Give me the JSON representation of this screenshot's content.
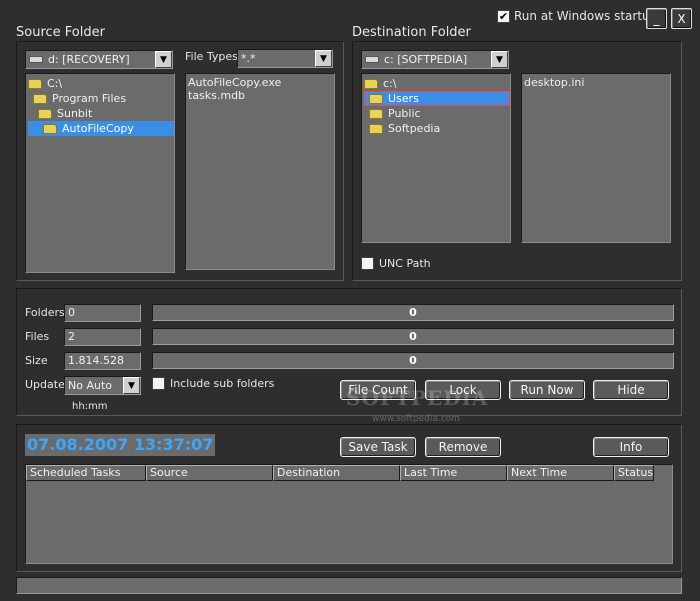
{
  "window": {
    "startup_label": "Run at Windows startup",
    "startup_checked": true,
    "minimize_glyph": "_",
    "close_glyph": "X"
  },
  "source": {
    "heading": "Source Folder",
    "drive": "d: [RECOVERY]",
    "file_types_label": "File Types",
    "file_types_value": "*.*",
    "tree": [
      {
        "label": "C:\\",
        "depth": 0,
        "selected": false
      },
      {
        "label": "Program Files",
        "depth": 1,
        "selected": false
      },
      {
        "label": "Sunbit",
        "depth": 2,
        "selected": false
      },
      {
        "label": "AutoFileCopy",
        "depth": 3,
        "selected": true
      }
    ],
    "files": [
      "AutoFileCopy.exe",
      "tasks.mdb"
    ]
  },
  "destination": {
    "heading": "Destination Folder",
    "drive": "c: [SOFTPEDIA]",
    "tree": [
      {
        "label": "c:\\",
        "depth": 0,
        "selected": false
      },
      {
        "label": "Users",
        "depth": 1,
        "selected": true
      },
      {
        "label": "Public",
        "depth": 1,
        "selected": false
      },
      {
        "label": "Softpedia",
        "depth": 1,
        "selected": false
      }
    ],
    "files": [
      "desktop.ini"
    ],
    "unc_label": "UNC Path",
    "unc_checked": false
  },
  "stats": {
    "folders_label": "Folders",
    "folders_value": "0",
    "folders_bar": "0",
    "files_label": "Files",
    "files_value": "2",
    "files_bar": "0",
    "size_label": "Size",
    "size_value": "1.814.528",
    "size_bar": "0",
    "update_label": "Update",
    "update_value": "No Auto",
    "update_hint": "hh:mm",
    "include_sub_label": "Include sub folders",
    "include_sub_checked": false
  },
  "actions": {
    "file_count": "File Count",
    "lock": "Lock",
    "run_now": "Run Now",
    "hide": "Hide"
  },
  "schedule": {
    "datetime": "07.08.2007 13:37:07",
    "save_task": "Save Task",
    "remove": "Remove",
    "info": "Info",
    "columns": [
      "Scheduled Tasks",
      "Source",
      "Destination",
      "Last Time",
      "Next Time",
      "Status"
    ]
  },
  "watermark": {
    "main": "SOFTPEDIA",
    "sub": "www.softpedia.com"
  }
}
